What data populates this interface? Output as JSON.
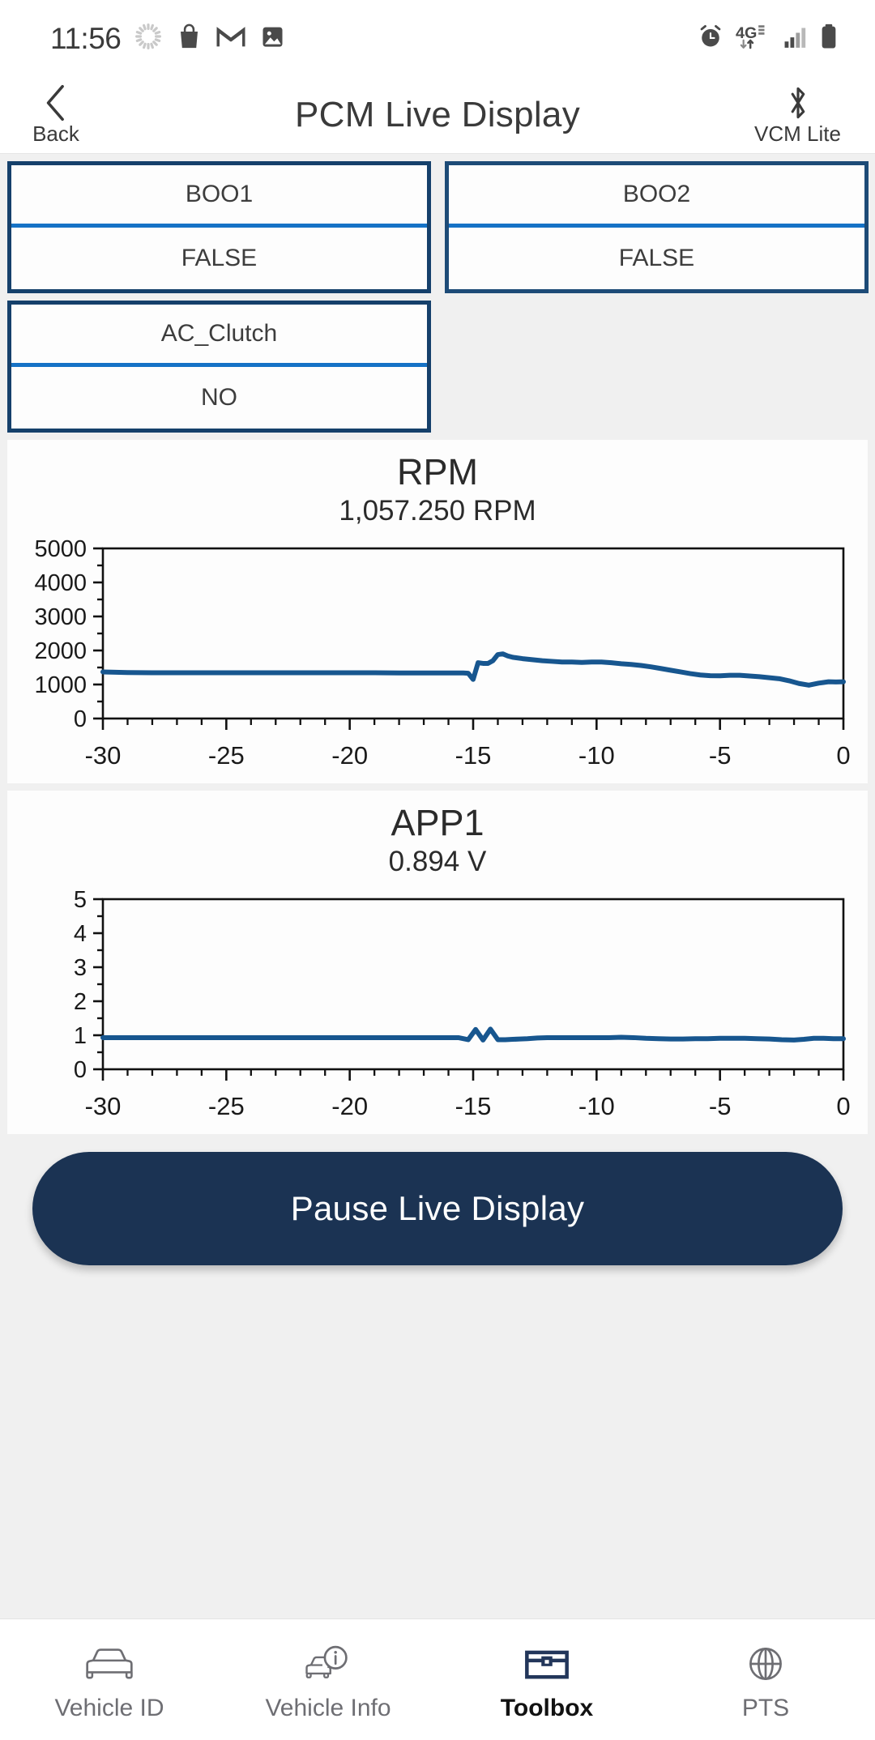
{
  "status_bar": {
    "time": "11:56",
    "left_icons": [
      "loading-spinner-icon",
      "shopping-bag-icon",
      "gmail-icon",
      "photos-icon"
    ],
    "right_icons": [
      "alarm-icon",
      "4g-network-icon",
      "signal-bars-icon",
      "battery-icon"
    ],
    "network_label": "4G"
  },
  "header": {
    "back_label": "Back",
    "title": "PCM Live Display",
    "device_label": "VCM Lite",
    "back_icon": "chevron-left-icon",
    "device_icon": "bluetooth-icon"
  },
  "pids": [
    {
      "name": "BOO1",
      "value": "FALSE"
    },
    {
      "name": "BOO2",
      "value": "FALSE"
    },
    {
      "name": "AC_Clutch",
      "value": "NO"
    }
  ],
  "charts": [
    {
      "title": "RPM",
      "subtitle": "1,057.250 RPM"
    },
    {
      "title": "APP1",
      "subtitle": "0.894 V"
    }
  ],
  "action": {
    "pause_label": "Pause Live Display"
  },
  "bottom_nav": {
    "items": [
      {
        "label": "Vehicle ID",
        "icon": "car-outline-icon",
        "active": false
      },
      {
        "label": "Vehicle Info",
        "icon": "car-info-icon",
        "active": false
      },
      {
        "label": "Toolbox",
        "icon": "toolbox-icon",
        "active": true
      },
      {
        "label": "PTS",
        "icon": "globe-icon",
        "active": false
      }
    ]
  },
  "colors": {
    "navy": "#15406b",
    "accent_blue": "#1572c6",
    "line": "#17568f",
    "button": "#1b3353",
    "page_bg": "#f0f0f0",
    "card_bg": "#fdfdfd"
  },
  "chart_data": [
    {
      "type": "line",
      "title": "RPM",
      "subtitle": "1,057.250 RPM",
      "current_value": 1057.25,
      "units": "RPM",
      "xlabel": "",
      "ylabel": "",
      "xlim": [
        -30,
        0
      ],
      "ylim": [
        0,
        5000
      ],
      "ytick_labels": [
        "0",
        "1000",
        "2000",
        "3000",
        "4000",
        "5000"
      ],
      "yticks": [
        0,
        1000,
        2000,
        3000,
        4000,
        5000
      ],
      "yticks_minor": [
        500,
        1500,
        2500,
        3500,
        4500
      ],
      "xtick_labels": [
        "-30",
        "-25",
        "-20",
        "-15",
        "-10",
        "-5",
        "0"
      ],
      "xticks": [
        -30,
        -25,
        -20,
        -15,
        -10,
        -5,
        0
      ],
      "grid": false,
      "legend": "none",
      "series": [
        {
          "name": "RPM",
          "x": [
            -30.0,
            -29.0,
            -28.0,
            -27.0,
            -26.0,
            -25.0,
            -24.0,
            -23.0,
            -22.0,
            -21.0,
            -20.0,
            -19.0,
            -18.0,
            -17.0,
            -16.0,
            -15.4,
            -15.2,
            -15.0,
            -14.8,
            -14.6,
            -14.4,
            -14.2,
            -14.0,
            -13.8,
            -13.6,
            -13.4,
            -13.0,
            -12.6,
            -12.2,
            -11.8,
            -11.4,
            -11.0,
            -10.6,
            -10.2,
            -9.8,
            -9.4,
            -9.0,
            -8.6,
            -8.2,
            -7.8,
            -7.4,
            -7.0,
            -6.6,
            -6.2,
            -5.8,
            -5.4,
            -5.0,
            -4.6,
            -4.2,
            -3.8,
            -3.4,
            -3.0,
            -2.6,
            -2.2,
            -1.8,
            -1.4,
            -1.0,
            -0.6,
            -0.3,
            0.0
          ],
          "y": [
            1370,
            1350,
            1345,
            1345,
            1345,
            1345,
            1345,
            1345,
            1345,
            1345,
            1345,
            1345,
            1340,
            1340,
            1340,
            1340,
            1330,
            1150,
            1640,
            1620,
            1620,
            1700,
            1880,
            1900,
            1840,
            1800,
            1760,
            1730,
            1700,
            1680,
            1660,
            1660,
            1650,
            1660,
            1660,
            1640,
            1610,
            1590,
            1560,
            1520,
            1470,
            1420,
            1370,
            1320,
            1280,
            1260,
            1255,
            1270,
            1270,
            1250,
            1230,
            1200,
            1170,
            1110,
            1030,
            980,
            1040,
            1080,
            1075,
            1080
          ],
          "color": "#17568f"
        }
      ]
    },
    {
      "type": "line",
      "title": "APP1",
      "subtitle": "0.894 V",
      "current_value": 0.894,
      "units": "V",
      "xlabel": "",
      "ylabel": "",
      "xlim": [
        -30,
        0
      ],
      "ylim": [
        0,
        5
      ],
      "ytick_labels": [
        "0",
        "1",
        "2",
        "3",
        "4",
        "5"
      ],
      "yticks": [
        0,
        1,
        2,
        3,
        4,
        5
      ],
      "yticks_minor": [
        0.5,
        1.5,
        2.5,
        3.5,
        4.5
      ],
      "xtick_labels": [
        "-30",
        "-25",
        "-20",
        "-15",
        "-10",
        "-5",
        "0"
      ],
      "xticks": [
        -30,
        -25,
        -20,
        -15,
        -10,
        -5,
        0
      ],
      "grid": false,
      "legend": "none",
      "series": [
        {
          "name": "APP1",
          "x": [
            -30.0,
            -28.0,
            -26.0,
            -24.0,
            -22.0,
            -20.0,
            -18.0,
            -16.5,
            -15.6,
            -15.2,
            -14.9,
            -14.6,
            -14.3,
            -14.0,
            -13.7,
            -13.4,
            -13.1,
            -12.8,
            -12.4,
            -12.0,
            -11.5,
            -11.0,
            -10.5,
            -10.0,
            -9.5,
            -9.0,
            -8.5,
            -8.0,
            -7.5,
            -7.0,
            -6.5,
            -6.0,
            -5.5,
            -5.0,
            -4.5,
            -4.0,
            -3.5,
            -3.0,
            -2.5,
            -2.0,
            -1.6,
            -1.2,
            -0.8,
            -0.4,
            0.0
          ],
          "y": [
            0.93,
            0.93,
            0.93,
            0.93,
            0.93,
            0.93,
            0.93,
            0.93,
            0.93,
            0.87,
            1.17,
            0.86,
            1.18,
            0.87,
            0.87,
            0.88,
            0.89,
            0.9,
            0.92,
            0.93,
            0.93,
            0.93,
            0.93,
            0.93,
            0.93,
            0.94,
            0.93,
            0.91,
            0.9,
            0.89,
            0.89,
            0.9,
            0.9,
            0.91,
            0.91,
            0.91,
            0.9,
            0.89,
            0.87,
            0.86,
            0.88,
            0.91,
            0.91,
            0.9,
            0.9
          ],
          "color": "#17568f"
        }
      ]
    }
  ]
}
